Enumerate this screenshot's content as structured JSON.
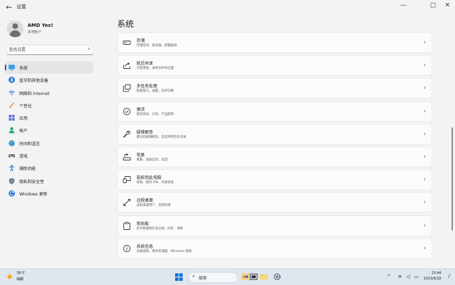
{
  "window": {
    "title": "设置",
    "minimize_glyph": "—",
    "maximize_glyph": "▢",
    "close_glyph": "✕"
  },
  "user": {
    "name": "AMD Yes!",
    "account_type": "本地帐户"
  },
  "search": {
    "placeholder": "查找设置"
  },
  "nav": {
    "items": [
      {
        "label": "系统",
        "icon": "system-icon",
        "selected": true
      },
      {
        "label": "蓝牙和其他设备",
        "icon": "bluetooth-icon"
      },
      {
        "label": "网络和 Internet",
        "icon": "wifi-icon"
      },
      {
        "label": "个性化",
        "icon": "brush-icon"
      },
      {
        "label": "应用",
        "icon": "apps-icon"
      },
      {
        "label": "帐户",
        "icon": "account-icon"
      },
      {
        "label": "时间和语言",
        "icon": "globe-icon"
      },
      {
        "label": "游戏",
        "icon": "gamepad-icon"
      },
      {
        "label": "辅助功能",
        "icon": "accessibility-icon"
      },
      {
        "label": "隐私和安全性",
        "icon": "shield-icon"
      },
      {
        "label": "Windows 更新",
        "icon": "update-icon"
      }
    ]
  },
  "main": {
    "title": "系统",
    "cards": [
      {
        "title": "存储",
        "desc": "存储空间、驱动器、配置规则",
        "icon": "storage-icon"
      },
      {
        "title": "就近共享",
        "desc": "可发现性，收到文件的位置",
        "icon": "share-icon"
      },
      {
        "title": "多任务处理",
        "desc": "贴靠窗口，桌面，任务切换",
        "icon": "multitask-icon"
      },
      {
        "title": "激活",
        "desc": "激活状态、订阅、产品密钥",
        "icon": "activation-icon"
      },
      {
        "title": "疑难解答",
        "desc": "建议的疑难解答、首选项和历史记录",
        "icon": "wrench-icon"
      },
      {
        "title": "恢复",
        "desc": "重置、高级启动、返回",
        "icon": "recovery-icon"
      },
      {
        "title": "投影到此电脑",
        "desc": "权限、配对 PIN、可发现性",
        "icon": "projection-icon"
      },
      {
        "title": "远程桌面",
        "desc": "远程桌面用户，连接权限",
        "icon": "remote-icon"
      },
      {
        "title": "剪贴板",
        "desc": "剪切和复制历史记录、同步、清除",
        "icon": "clipboard-icon"
      },
      {
        "title": "系统信息",
        "desc": "设备规格、重命名电脑、Windows 规格",
        "icon": "info-icon"
      }
    ]
  },
  "taskbar": {
    "weather_temp": "39°C",
    "weather_desc": "晴朗",
    "search_label": "搜索",
    "time": "13:44",
    "date": "2023/6/18"
  },
  "colors": {
    "accent": "#005fb8",
    "background": "#f3f3f3",
    "card": "#fbfbfb",
    "taskbar": "#dfe6ee"
  }
}
